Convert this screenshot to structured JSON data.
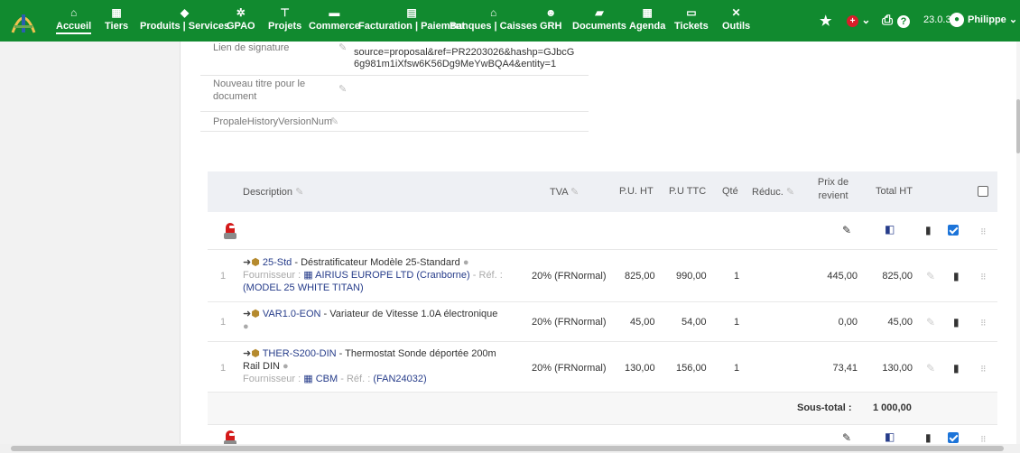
{
  "nav": {
    "items": [
      {
        "icon": "home-icon",
        "glyph": "⌂",
        "label": "Accueil"
      },
      {
        "icon": "building-icon",
        "glyph": "▦",
        "label": "Tiers"
      },
      {
        "icon": "cube-icon",
        "glyph": "◆",
        "label": "Produits | Services"
      },
      {
        "icon": "cogs-icon",
        "glyph": "✲",
        "label": "GPAO"
      },
      {
        "icon": "sitemap-icon",
        "glyph": "⊤",
        "label": "Projets"
      },
      {
        "icon": "briefcase-icon",
        "glyph": "▬",
        "label": "Commerce"
      },
      {
        "icon": "file-invoice-icon",
        "glyph": "▤",
        "label": "Facturation | Paiement"
      },
      {
        "icon": "bank-icon",
        "glyph": "⌂",
        "label": "Banques | Caisses"
      },
      {
        "icon": "users-icon",
        "glyph": "☻",
        "label": "GRH"
      },
      {
        "icon": "folder-icon",
        "glyph": "▰",
        "label": "Documents"
      },
      {
        "icon": "calendar-icon",
        "glyph": "▦",
        "label": "Agenda"
      },
      {
        "icon": "ticket-icon",
        "glyph": "▭",
        "label": "Tickets"
      },
      {
        "icon": "tools-icon",
        "glyph": "✕",
        "label": "Outils"
      }
    ],
    "version": "23.0.3",
    "user": "Philippe"
  },
  "attributes": [
    {
      "label": "Lien de signature",
      "value_lines": [
        "source=proposal&ref=PR2203026&hashp=GJbcG",
        "6g981m1iXfsw6K56Dg9MeYwBQA4&entity=1"
      ]
    },
    {
      "label": "Nouveau titre pour le document",
      "value_lines": []
    },
    {
      "label": "PropaleHistoryVersionNum",
      "value_lines": []
    }
  ],
  "table": {
    "headers": {
      "description": "Description",
      "tva": "TVA",
      "pu_ht": "P.U. HT",
      "pu_ttc": "P.U TTC",
      "qte": "Qté",
      "reduc": "Réduc.",
      "prix_revient": "Prix de revient",
      "total_ht": "Total HT"
    },
    "lines": [
      {
        "num": "1",
        "ref": "25-Std",
        "label": "Déstratificateur Modèle 25-Standard",
        "supplier_prefix": "Fournisseur :",
        "supplier": "AIRIUS EUROPE LTD (Cranborne)",
        "ref_prefix": "Réf. :",
        "supplier_ref": "(MODEL 25 WHITE TITAN)",
        "tva": "20% (FRNormal)",
        "pu_ht": "825,00",
        "pu_ttc": "990,00",
        "qte": "1",
        "prix_revient": "445,00",
        "total_ht": "825,00"
      },
      {
        "num": "1",
        "ref": "VAR1.0-EON",
        "label": "Variateur de Vitesse 1.0A électronique",
        "tva": "20% (FRNormal)",
        "pu_ht": "45,00",
        "pu_ttc": "54,00",
        "qte": "1",
        "prix_revient": "0,00",
        "total_ht": "45,00"
      },
      {
        "num": "1",
        "ref": "THER-S200-DIN",
        "label": "Thermostat Sonde déportée 200m Rail DIN",
        "supplier_prefix": "Fournisseur :",
        "supplier": "CBM",
        "ref_prefix": "Réf. :",
        "supplier_ref": "(FAN24032)",
        "tva": "20% (FRNormal)",
        "pu_ht": "130,00",
        "pu_ttc": "156,00",
        "qte": "1",
        "prix_revient": "73,41",
        "total_ht": "130,00"
      }
    ],
    "subtotal_label": "Sous-total :",
    "subtotal_value": "1 000,00"
  }
}
